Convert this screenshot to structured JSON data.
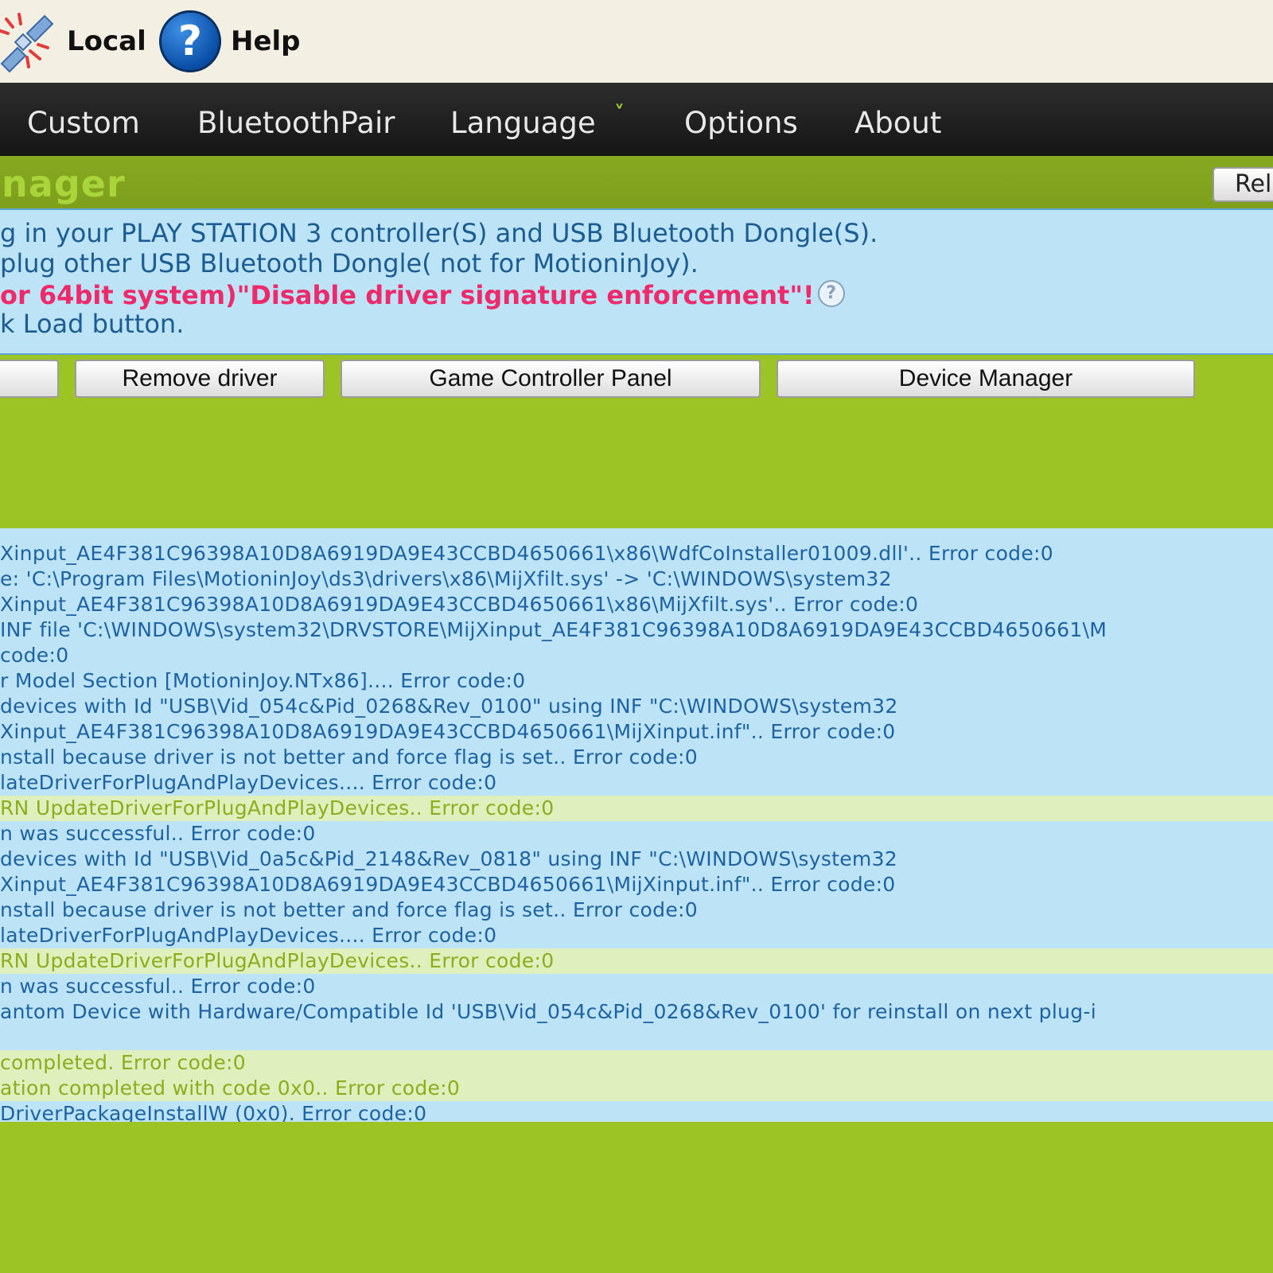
{
  "toolbar": {
    "local_label": "Local",
    "help_label": "Help",
    "help_glyph": "?"
  },
  "nav": {
    "items": [
      "Custom",
      "BluetoothPair",
      "Language",
      "Options",
      "About"
    ],
    "chevron": "˅"
  },
  "manager": {
    "title": "anager",
    "reload_label": "Rel"
  },
  "instructions": {
    "line1": "g in your PLAY STATION 3 controller(S) and USB Bluetooth Dongle(S).",
    "line2": "plug other USB Bluetooth Dongle( not for MotioninJoy).",
    "line3": "or 64bit system)\"Disable driver signature enforcement\"!",
    "line4": "k Load button.",
    "help_glyph": "?"
  },
  "buttons": {
    "load_label": "",
    "remove_label": "Remove driver",
    "game_panel_label": "Game Controller Panel",
    "device_manager_label": "Device Manager"
  },
  "log": {
    "rows": [
      "Xinput_AE4F381C96398A10D8A6919DA9E43CCBD4650661\\x86\\WdfCoInstaller01009.dll'.. Error code:0",
      "e: 'C:\\Program Files\\MotioninJoy\\ds3\\drivers\\x86\\MijXfilt.sys' -> 'C:\\WINDOWS\\system32",
      "Xinput_AE4F381C96398A10D8A6919DA9E43CCBD4650661\\x86\\MijXfilt.sys'.. Error code:0",
      "INF file 'C:\\WINDOWS\\system32\\DRVSTORE\\MijXinput_AE4F381C96398A10D8A6919DA9E43CCBD4650661\\M",
      " code:0",
      "r Model Section [MotioninJoy.NTx86].... Error code:0",
      "devices with Id \"USB\\Vid_054c&Pid_0268&Rev_0100\" using INF \"C:\\WINDOWS\\system32",
      "Xinput_AE4F381C96398A10D8A6919DA9E43CCBD4650661\\MijXinput.inf\".. Error code:0",
      "nstall because driver is not better and force flag is set.. Error code:0",
      "lateDriverForPlugAndPlayDevices.... Error code:0",
      "RN UpdateDriverForPlugAndPlayDevices.. Error code:0",
      "n was successful.. Error code:0",
      "devices with Id \"USB\\Vid_0a5c&Pid_2148&Rev_0818\" using INF \"C:\\WINDOWS\\system32",
      "Xinput_AE4F381C96398A10D8A6919DA9E43CCBD4650661\\MijXinput.inf\".. Error code:0",
      "nstall because driver is not better and force flag is set.. Error code:0",
      "lateDriverForPlugAndPlayDevices.... Error code:0",
      "RN UpdateDriverForPlugAndPlayDevices.. Error code:0",
      "n was successful.. Error code:0",
      "antom Device with Hardware/Compatible Id 'USB\\Vid_054c&Pid_0268&Rev_0100' for reinstall on next plug-i",
      "",
      " completed. Error code:0",
      "ation completed with code 0x0.. Error code:0",
      "DriverPackageInstallW (0x0). Error code:0"
    ]
  },
  "colors": {
    "toolbar_bg": "#f3f0e3",
    "nav_bg": "#1f1f1f",
    "page_green": "#9bc424",
    "panel_blue": "#bde3f6",
    "log_text": "#1d63a3",
    "highlight_row": "#e0f0bd",
    "warning_text": "#ee2a6b"
  }
}
